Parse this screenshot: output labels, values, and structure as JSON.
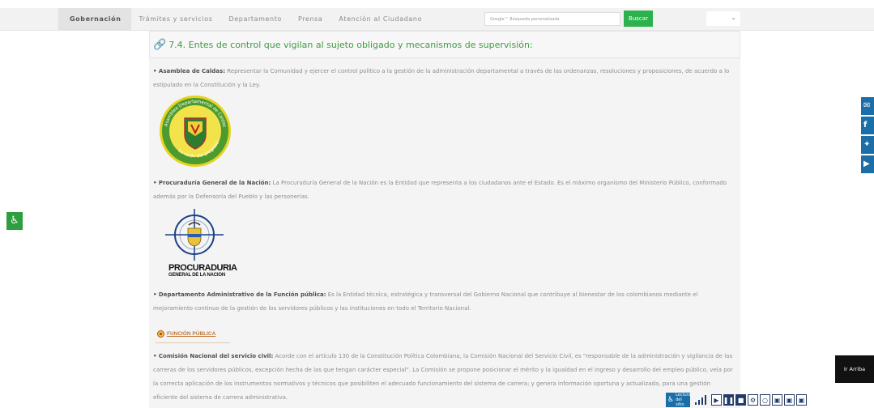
{
  "nav": {
    "items": [
      {
        "label": "Gobernación",
        "active": true
      },
      {
        "label": "Trámites y servicios",
        "active": false
      },
      {
        "label": "Departamento",
        "active": false
      },
      {
        "label": "Prensa",
        "active": false
      },
      {
        "label": "Atención al Ciudadano",
        "active": false
      }
    ],
    "search_placeholder": "Google™ Búsqueda personalizada",
    "search_button": "Buscar"
  },
  "section": {
    "title": "7.4. Entes de control que vigilan al sujeto obligado y mecanismos de supervisión:"
  },
  "entries": [
    {
      "name": "• Asamblea de Caldas:",
      "text": " Representar la Comunidad y ejercer el control político a la gestión de la administración departamental a través de las ordenanzas, resoluciones y proposiciones, de acuerdo a lo estipulado en la Constitución y la Ley."
    },
    {
      "name": "• Procuraduría General de la Nación:",
      "text": " La Procuraduría General de la Nación es la Entidad que representa a los ciudadanos ante el Estado. Es el máximo organismo del Ministerio Público, conformado además por la Defensoría del Pueblo y las personerías."
    },
    {
      "name": "• Departamento Administrativo de la Función pública:",
      "text": " Es la Entidad técnica, estratégica y transversal del Gobierno Nacional que contribuye al bienestar de los colombianos mediante el mejoramiento continuo de la gestión de los servidores públicos y las instituciones en todo el Territorio Nacional."
    },
    {
      "name": "• Comisión Nacional del servicio civil:",
      "text": " Acorde con el artículo 130 de la Constitución Política Colombiana, la Comisión Nacional del Servicio Civil, es \"responsable de la administración y vigilancia de las carreras de los servidores públicos, excepción hecha de las que tengan carácter especial\". La Comisión se propone posicionar el mérito y la igualdad en el ingreso y desarrollo del empleo público, vela por la correcta aplicación de los instrumentos normativos y técnicos que posibiliten el adecuado funcionamiento del sistema de carrera; y genera información oportuna y actualizada, para una gestión eficiente del sistema de carrera administrativa."
    }
  ],
  "logos": {
    "caldas_ring": "Asamblea Departamental de Caldas",
    "caldas_motto": "La razón del progreso",
    "procuraduria_line1": "PROCURADURIA",
    "procuraduria_line2": "GENERAL DE LA NACION",
    "funcion_publica": "FUNCIÓN PÚBLICA"
  },
  "widgets": {
    "ir_arriba": "Ir Arriba",
    "lectura_label": "Lectura del sitio",
    "social": [
      "email",
      "facebook",
      "twitter",
      "youtube"
    ]
  },
  "colors": {
    "accent_green": "#2bb24c",
    "title_green": "#3f9b3f",
    "social_blue": "#1b6ea8"
  }
}
